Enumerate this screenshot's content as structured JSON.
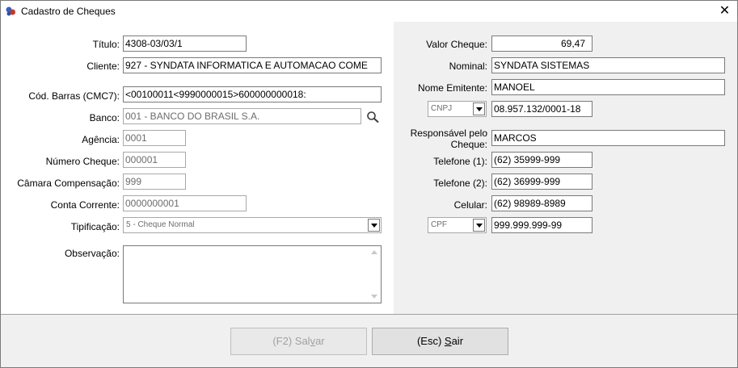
{
  "window": {
    "title": "Cadastro de Cheques",
    "close_symbol": "✕"
  },
  "left": {
    "titulo": {
      "label": "Título:",
      "value": "4308-03/03/1"
    },
    "cliente": {
      "label": "Cliente:",
      "value": "927 - SYNDATA INFORMATICA E AUTOMACAO COME"
    },
    "cod_barras": {
      "label": "Cód. Barras (CMC7):",
      "value": "<00100011<9990000015>600000000018:"
    },
    "banco": {
      "label": "Banco:",
      "value": "001 - BANCO DO BRASIL S.A."
    },
    "agencia": {
      "label": "Agência:",
      "value": "0001"
    },
    "numero_cheque": {
      "label": "Número Cheque:",
      "value": "000001"
    },
    "camara": {
      "label": "Câmara Compensação:",
      "value": "999"
    },
    "conta": {
      "label": "Conta Corrente:",
      "value": "0000000001"
    },
    "tipificacao": {
      "label": "Tipificação:",
      "value": "5 - Cheque Normal"
    },
    "observacao": {
      "label": "Observação:",
      "value": ""
    }
  },
  "right": {
    "valor": {
      "label": "Valor Cheque:",
      "value": "69,47"
    },
    "nominal": {
      "label": "Nominal:",
      "value": "SYNDATA SISTEMAS"
    },
    "emitente": {
      "label": "Nome Emitente:",
      "value": "MANOEL"
    },
    "doc_tipo_emitente": "CNPJ",
    "doc_emitente": "08.957.132/0001-18",
    "responsavel": {
      "label_line1": "Responsável pelo",
      "label_line2": "Cheque:",
      "value": "MARCOS"
    },
    "telefone1": {
      "label": "Telefone (1):",
      "value": "(62) 35999-999"
    },
    "telefone2": {
      "label": "Telefone (2):",
      "value": "(62) 36999-999"
    },
    "celular": {
      "label": "Celular:",
      "value": "(62) 98989-8989"
    },
    "doc_tipo_responsavel": "CPF",
    "doc_responsavel": "999.999.999-99"
  },
  "footer": {
    "salvar_pre": "(F2) Sal",
    "salvar_key": "v",
    "salvar_post": "ar",
    "sair_pre": "(Esc) ",
    "sair_key": "S",
    "sair_post": "air"
  },
  "colors": {
    "panel": "#f0f0f0",
    "border": "#7a7a7a",
    "disabled_text": "#6d6d6d"
  }
}
